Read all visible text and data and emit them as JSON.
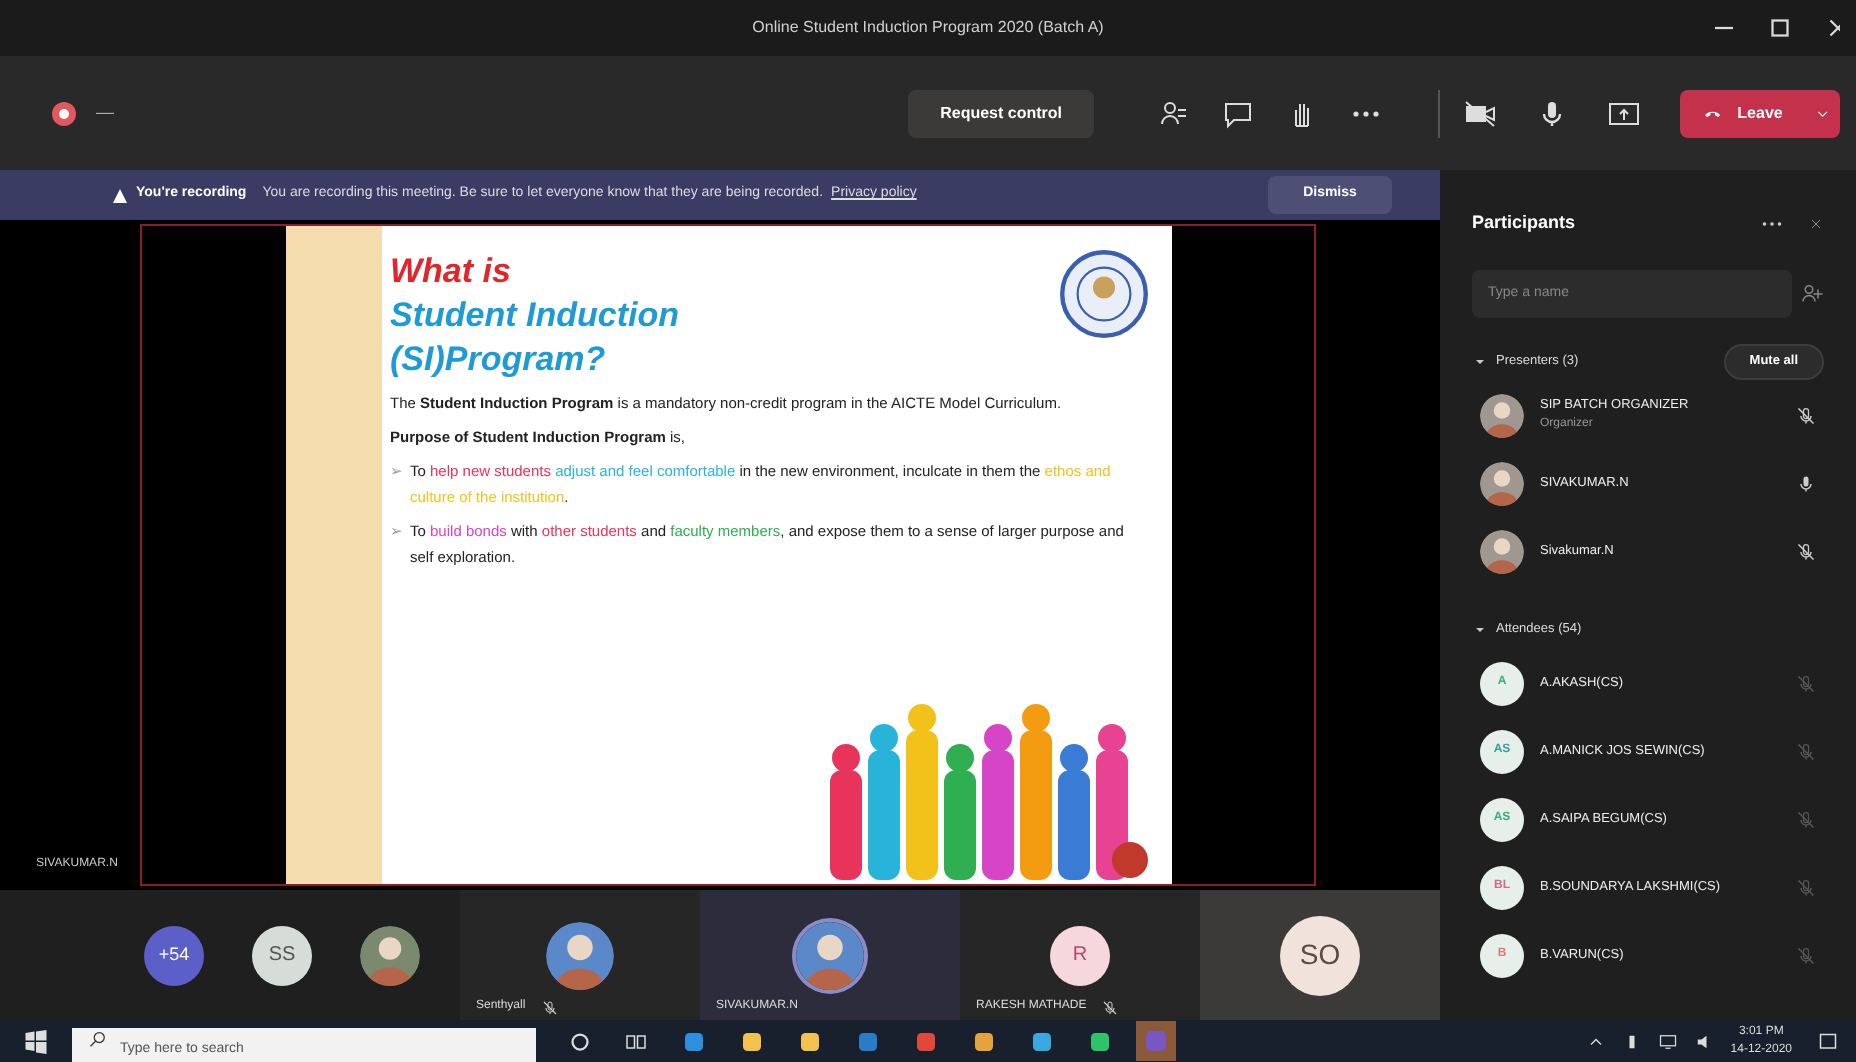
{
  "window": {
    "title": "Online Student Induction Program 2020 (Batch A)"
  },
  "toolbar": {
    "timer": "—",
    "request_control": "Request control",
    "leave": "Leave"
  },
  "banner": {
    "heading": "You're recording",
    "message": "You are recording this meeting. Be sure to let everyone know that they are being recorded.",
    "link": "Privacy policy",
    "dismiss": "Dismiss"
  },
  "slide": {
    "title_lines": [
      {
        "text": "What is",
        "color": "#e0262b"
      },
      {
        "text": "Student Induction",
        "color": "#1e9ad6"
      },
      {
        "text": "(SI)Program?",
        "color": "#1e9ad6"
      }
    ],
    "intro": "The **Student Induction Program** is a mandatory non-credit program in the AICTE Model Curriculum.",
    "purpose": "**Purpose of Student Induction Program** is,",
    "bullets": [
      {
        "marker": "➢",
        "segments": [
          {
            "text": "To "
          },
          {
            "text": "help new students",
            "color": "#e8335a"
          },
          {
            "text": " adjust and feel comfortable",
            "color": "#27b4d8"
          },
          {
            "text": " in the new environment, inculcate in them the "
          },
          {
            "text": "ethos and culture of the institution",
            "color": "#f2c21b"
          },
          {
            "text": "."
          }
        ]
      },
      {
        "marker": "➢",
        "segments": [
          {
            "text": "To "
          },
          {
            "text": "build bonds",
            "color": "#d644c8"
          },
          {
            "text": " with "
          },
          {
            "text": "other students",
            "color": "#e8335a"
          },
          {
            "text": " and "
          },
          {
            "text": "faculty members",
            "color": "#2fae52"
          },
          {
            "text": ", and expose them to a sense of larger purpose and self exploration."
          }
        ]
      }
    ]
  },
  "presenter_label": "SIVAKUMAR.N",
  "gallery": {
    "avatars": [
      {
        "kind": "counter",
        "text": "+54"
      },
      {
        "kind": "initials",
        "text": "SS"
      },
      {
        "kind": "photo"
      }
    ],
    "tiles": [
      {
        "kind": "photo",
        "name": "Senthyall",
        "muted": true,
        "speaking": false
      },
      {
        "kind": "photo",
        "name": "SIVAKUMAR.N",
        "muted": false,
        "speaking": true
      },
      {
        "kind": "initials",
        "initials": "R",
        "name": "RAKESH MATHADE",
        "muted": true,
        "speaking": false
      },
      {
        "kind": "initials",
        "initials": "SO"
      }
    ]
  },
  "participants": {
    "title": "Participants",
    "search": {
      "placeholder": "Type a name"
    },
    "groups": [
      {
        "label": "Presenters (3)",
        "expanded": true,
        "action": "Mute all",
        "members": [
          {
            "kind": "photo",
            "name": "SIP BATCH ORGANIZER",
            "role": "Organizer",
            "muted": true
          },
          {
            "kind": "photo",
            "name": "SIVAKUMAR.N",
            "muted": false
          },
          {
            "kind": "photo",
            "name": "Sivakumar.N",
            "muted": true
          }
        ]
      },
      {
        "label": "Attendees (54)",
        "expanded": true,
        "members": [
          {
            "kind": "initials",
            "initials": "A",
            "color": "#3fae7a",
            "name": "A.AKASH(CS)",
            "muted": true
          },
          {
            "kind": "initials",
            "initials": "AS",
            "color": "#3aa39a",
            "name": "A.MANICK JOS SEWIN(CS)",
            "muted": true
          },
          {
            "kind": "initials",
            "initials": "AS",
            "color": "#3fae7a",
            "name": "A.SAIPA BEGUM(CS)",
            "muted": true
          },
          {
            "kind": "initials",
            "initials": "BL",
            "color": "#d36a8c",
            "name": "B.SOUNDARYA LAKSHMI(CS)",
            "muted": true
          },
          {
            "kind": "initials",
            "initials": "B",
            "color": "#e07a7a",
            "name": "B.VARUN(CS)",
            "muted": true
          }
        ]
      }
    ]
  },
  "taskbar": {
    "search": {
      "placeholder": "Type here to search"
    },
    "time": "3:01 PM",
    "date": "14-12-2020"
  }
}
